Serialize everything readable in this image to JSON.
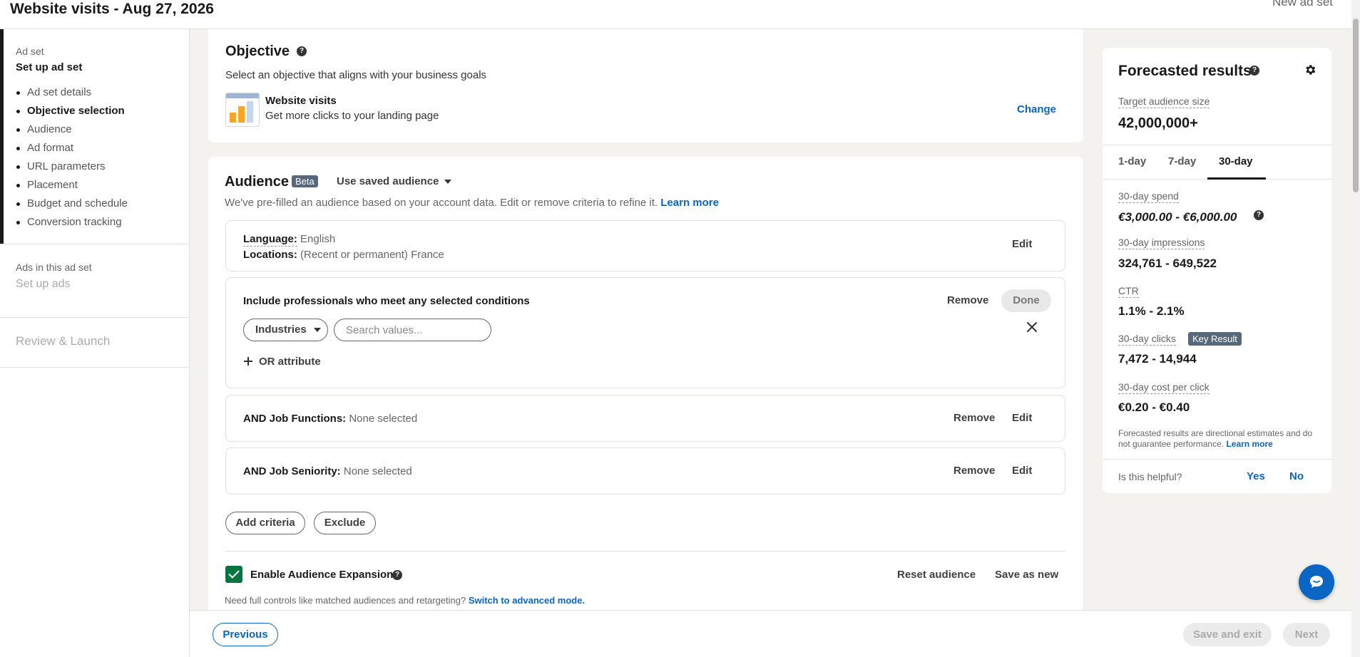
{
  "header": {
    "title": "Website visits - Aug 27, 2026",
    "new_ad_set": "New ad set"
  },
  "sidebar": {
    "eyebrow": "Ad set",
    "heading": "Set up ad set",
    "items": [
      {
        "label": "Ad set details"
      },
      {
        "label": "Objective selection"
      },
      {
        "label": "Audience"
      },
      {
        "label": "Ad format"
      },
      {
        "label": "URL parameters"
      },
      {
        "label": "Placement"
      },
      {
        "label": "Budget and schedule"
      },
      {
        "label": "Conversion tracking"
      }
    ],
    "current_item": "Objective selection",
    "ads_eyebrow": "Ads in this ad set",
    "ads_heading": "Set up ads",
    "review": "Review & Launch"
  },
  "objective": {
    "title": "Objective",
    "subtitle": "Select an objective that aligns with your business goals",
    "name": "Website visits",
    "description": "Get more clicks to your landing page",
    "change": "Change"
  },
  "audience": {
    "title": "Audience",
    "badge": "Beta",
    "saved_audience": "Use saved audience",
    "description": "We've pre-filled an audience based on your account data. Edit or remove criteria to refine it.",
    "learn_more": "Learn more",
    "language_label": "Language:",
    "language_value": "English",
    "locations_label": "Locations:",
    "locations_value": "(Recent or permanent) France",
    "edit": "Edit",
    "include_title": "Include professionals who meet any selected conditions",
    "remove": "Remove",
    "done": "Done",
    "industries": "Industries",
    "search_placeholder": "Search values...",
    "or_attribute": "OR attribute",
    "job_functions_label": "AND Job Functions:",
    "job_functions_value": "None selected",
    "job_seniority_label": "AND Job Seniority:",
    "job_seniority_value": "None selected",
    "add_criteria": "Add criteria",
    "exclude": "Exclude",
    "expansion_label": "Enable Audience Expansion",
    "expansion_enabled": true,
    "reset": "Reset audience",
    "save_as_new": "Save as new",
    "advanced_note": "Need full controls like matched audiences and retargeting?",
    "advanced_link": "Switch to advanced mode."
  },
  "footer": {
    "previous": "Previous",
    "save_exit": "Save and exit",
    "next": "Next"
  },
  "forecast": {
    "title": "Forecasted results",
    "audience_size_label": "Target audience size",
    "audience_size": "42,000,000+",
    "tabs": [
      "1-day",
      "7-day",
      "30-day"
    ],
    "active_tab": "30-day",
    "spend_label": "30-day spend",
    "spend": "€3,000.00 - €6,000.00",
    "impressions_label": "30-day impressions",
    "impressions": "324,761 - 649,522",
    "ctr_label": "CTR",
    "ctr": "1.1% - 2.1%",
    "clicks_label": "30-day clicks",
    "key_result": "Key Result",
    "clicks": "7,472 - 14,944",
    "cpc_label": "30-day cost per click",
    "cpc": "€0.20 - €0.40",
    "disclaimer": "Forecasted results are directional estimates and do not guarantee performance.",
    "learn_more": "Learn more",
    "helpful_q": "Is this helpful?",
    "yes": "Yes",
    "no": "No"
  },
  "colors": {
    "accent": "#0a66c2",
    "checkbox": "#057642",
    "badge": "#56687a"
  }
}
